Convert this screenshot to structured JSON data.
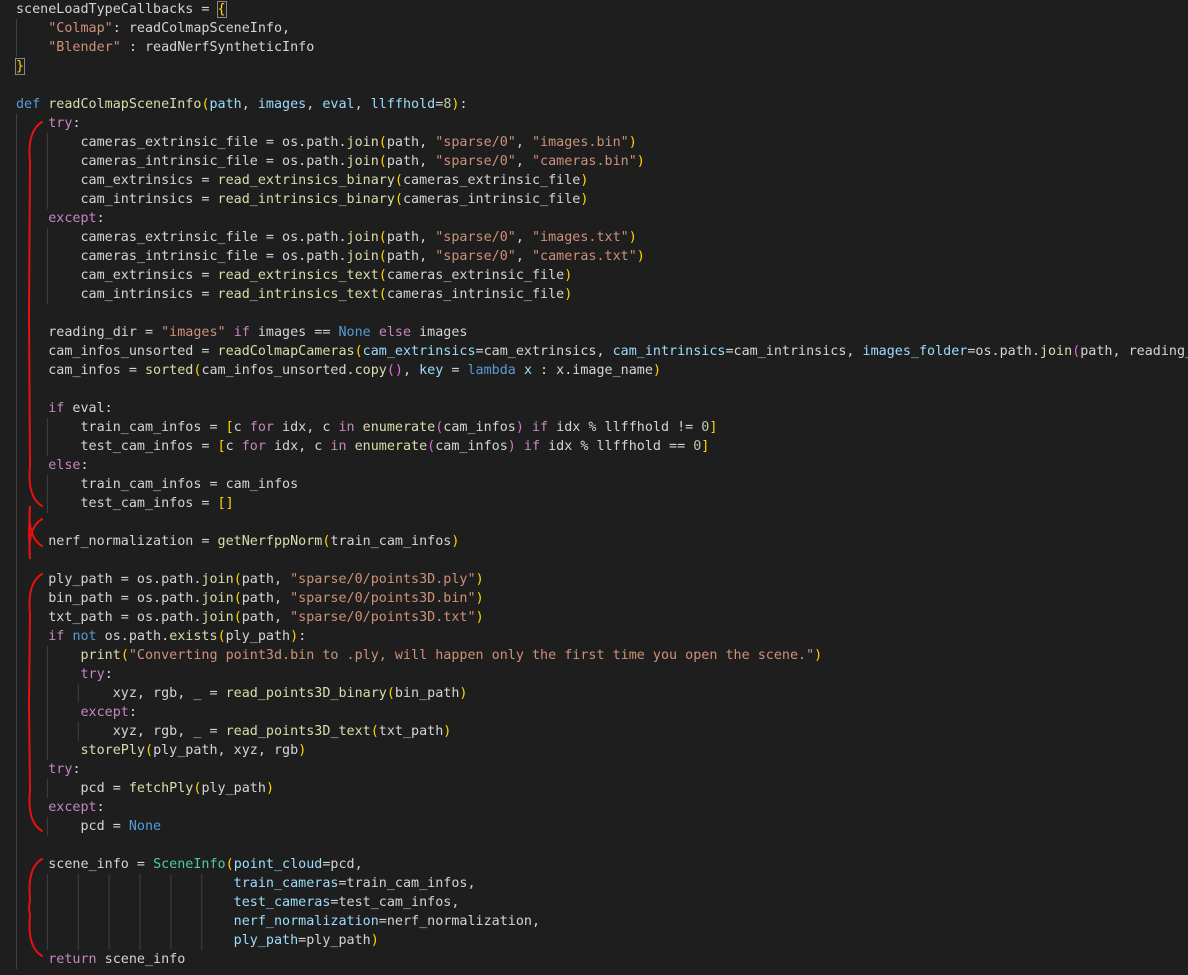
{
  "editor": {
    "language": "python",
    "colors": {
      "background": "#1e1e1e",
      "indent_guide": "#404040",
      "annotation": "#e81010"
    },
    "lines": [
      [
        [
          "sceneLoadTypeCallbacks = ",
          "op"
        ],
        [
          "{",
          "b1"
        ]
      ],
      [
        [
          "    ",
          ""
        ],
        [
          "\"Colmap\"",
          "str"
        ],
        [
          ": readColmapSceneInfo,",
          "op"
        ]
      ],
      [
        [
          "    ",
          ""
        ],
        [
          "\"Blender\"",
          "str"
        ],
        [
          " : readNerfSyntheticInfo",
          "op"
        ]
      ],
      [
        [
          "}",
          "b1"
        ]
      ],
      [],
      [
        [
          "def ",
          "kwb"
        ],
        [
          "readColmapSceneInfo",
          "fn"
        ],
        [
          "(",
          "b1"
        ],
        [
          "path",
          "var"
        ],
        [
          ", ",
          "op"
        ],
        [
          "images",
          "var"
        ],
        [
          ", ",
          "op"
        ],
        [
          "eval",
          "var"
        ],
        [
          ", ",
          "op"
        ],
        [
          "llffhold",
          "var"
        ],
        [
          "=",
          "op"
        ],
        [
          "8",
          "num"
        ],
        [
          ")",
          "b1"
        ],
        [
          ":",
          "op"
        ]
      ],
      [
        [
          "    ",
          ""
        ],
        [
          "try",
          "kw"
        ],
        [
          ":",
          "op"
        ]
      ],
      [
        [
          "        cameras_extrinsic_file = os.path.",
          "op"
        ],
        [
          "join",
          "fn"
        ],
        [
          "(",
          "b1"
        ],
        [
          "path, ",
          "op"
        ],
        [
          "\"sparse/0\"",
          "str"
        ],
        [
          ", ",
          "op"
        ],
        [
          "\"images.bin\"",
          "str"
        ],
        [
          ")",
          "b1"
        ]
      ],
      [
        [
          "        cameras_intrinsic_file = os.path.",
          "op"
        ],
        [
          "join",
          "fn"
        ],
        [
          "(",
          "b1"
        ],
        [
          "path, ",
          "op"
        ],
        [
          "\"sparse/0\"",
          "str"
        ],
        [
          ", ",
          "op"
        ],
        [
          "\"cameras.bin\"",
          "str"
        ],
        [
          ")",
          "b1"
        ]
      ],
      [
        [
          "        cam_extrinsics = ",
          "op"
        ],
        [
          "read_extrinsics_binary",
          "fn"
        ],
        [
          "(",
          "b1"
        ],
        [
          "cameras_extrinsic_file",
          "op"
        ],
        [
          ")",
          "b1"
        ]
      ],
      [
        [
          "        cam_intrinsics = ",
          "op"
        ],
        [
          "read_intrinsics_binary",
          "fn"
        ],
        [
          "(",
          "b1"
        ],
        [
          "cameras_intrinsic_file",
          "op"
        ],
        [
          ")",
          "b1"
        ]
      ],
      [
        [
          "    ",
          ""
        ],
        [
          "except",
          "kw"
        ],
        [
          ":",
          "op"
        ]
      ],
      [
        [
          "        cameras_extrinsic_file = os.path.",
          "op"
        ],
        [
          "join",
          "fn"
        ],
        [
          "(",
          "b1"
        ],
        [
          "path, ",
          "op"
        ],
        [
          "\"sparse/0\"",
          "str"
        ],
        [
          ", ",
          "op"
        ],
        [
          "\"images.txt\"",
          "str"
        ],
        [
          ")",
          "b1"
        ]
      ],
      [
        [
          "        cameras_intrinsic_file = os.path.",
          "op"
        ],
        [
          "join",
          "fn"
        ],
        [
          "(",
          "b1"
        ],
        [
          "path, ",
          "op"
        ],
        [
          "\"sparse/0\"",
          "str"
        ],
        [
          ", ",
          "op"
        ],
        [
          "\"cameras.txt\"",
          "str"
        ],
        [
          ")",
          "b1"
        ]
      ],
      [
        [
          "        cam_extrinsics = ",
          "op"
        ],
        [
          "read_extrinsics_text",
          "fn"
        ],
        [
          "(",
          "b1"
        ],
        [
          "cameras_extrinsic_file",
          "op"
        ],
        [
          ")",
          "b1"
        ]
      ],
      [
        [
          "        cam_intrinsics = ",
          "op"
        ],
        [
          "read_intrinsics_text",
          "fn"
        ],
        [
          "(",
          "b1"
        ],
        [
          "cameras_intrinsic_file",
          "op"
        ],
        [
          ")",
          "b1"
        ]
      ],
      [],
      [
        [
          "    reading_dir = ",
          "op"
        ],
        [
          "\"images\"",
          "str"
        ],
        [
          " ",
          ""
        ],
        [
          "if",
          "kw"
        ],
        [
          " images == ",
          "op"
        ],
        [
          "None",
          "kwb"
        ],
        [
          " ",
          ""
        ],
        [
          "else",
          "kw"
        ],
        [
          " images",
          "op"
        ]
      ],
      [
        [
          "    cam_infos_unsorted = ",
          "op"
        ],
        [
          "readColmapCameras",
          "fn"
        ],
        [
          "(",
          "b1"
        ],
        [
          "cam_extrinsics",
          "var"
        ],
        [
          "=cam_extrinsics, ",
          "op"
        ],
        [
          "cam_intrinsics",
          "var"
        ],
        [
          "=cam_intrinsics, ",
          "op"
        ],
        [
          "images_folder",
          "var"
        ],
        [
          "=os.path.",
          "op"
        ],
        [
          "join",
          "fn"
        ],
        [
          "(",
          "b2"
        ],
        [
          "path, reading_dir",
          "op"
        ],
        [
          ")",
          "b2"
        ],
        [
          ")",
          "b1"
        ]
      ],
      [
        [
          "    cam_infos = ",
          "op"
        ],
        [
          "sorted",
          "fn"
        ],
        [
          "(",
          "b1"
        ],
        [
          "cam_infos_unsorted.",
          "op"
        ],
        [
          "copy",
          "fn"
        ],
        [
          "()",
          "b2"
        ],
        [
          ", ",
          "op"
        ],
        [
          "key",
          "var"
        ],
        [
          " = ",
          "op"
        ],
        [
          "lambda",
          "kwb"
        ],
        [
          " ",
          ""
        ],
        [
          "x",
          "var"
        ],
        [
          " : x.image_name",
          "op"
        ],
        [
          ")",
          "b1"
        ]
      ],
      [],
      [
        [
          "    ",
          ""
        ],
        [
          "if",
          "kw"
        ],
        [
          " eval:",
          "op"
        ]
      ],
      [
        [
          "        train_cam_infos = ",
          "op"
        ],
        [
          "[",
          "b1"
        ],
        [
          "c ",
          "op"
        ],
        [
          "for",
          "kw"
        ],
        [
          " idx, c ",
          "op"
        ],
        [
          "in",
          "kw"
        ],
        [
          " ",
          ""
        ],
        [
          "enumerate",
          "fn"
        ],
        [
          "(",
          "b2"
        ],
        [
          "cam_infos",
          "op"
        ],
        [
          ")",
          "b2"
        ],
        [
          " ",
          ""
        ],
        [
          "if",
          "kw"
        ],
        [
          " idx % llffhold != ",
          "op"
        ],
        [
          "0",
          "num"
        ],
        [
          "]",
          "b1"
        ]
      ],
      [
        [
          "        test_cam_infos = ",
          "op"
        ],
        [
          "[",
          "b1"
        ],
        [
          "c ",
          "op"
        ],
        [
          "for",
          "kw"
        ],
        [
          " idx, c ",
          "op"
        ],
        [
          "in",
          "kw"
        ],
        [
          " ",
          ""
        ],
        [
          "enumerate",
          "fn"
        ],
        [
          "(",
          "b2"
        ],
        [
          "cam_infos",
          "op"
        ],
        [
          ")",
          "b2"
        ],
        [
          " ",
          ""
        ],
        [
          "if",
          "kw"
        ],
        [
          " idx % llffhold == ",
          "op"
        ],
        [
          "0",
          "num"
        ],
        [
          "]",
          "b1"
        ]
      ],
      [
        [
          "    ",
          ""
        ],
        [
          "else",
          "kw"
        ],
        [
          ":",
          "op"
        ]
      ],
      [
        [
          "        train_cam_infos = cam_infos",
          "op"
        ]
      ],
      [
        [
          "        test_cam_infos = ",
          "op"
        ],
        [
          "[]",
          "b1"
        ]
      ],
      [],
      [
        [
          "    nerf_normalization = ",
          "op"
        ],
        [
          "getNerfppNorm",
          "fn"
        ],
        [
          "(",
          "b1"
        ],
        [
          "train_cam_infos",
          "op"
        ],
        [
          ")",
          "b1"
        ]
      ],
      [],
      [
        [
          "    ply_path = os.path.",
          "op"
        ],
        [
          "join",
          "fn"
        ],
        [
          "(",
          "b1"
        ],
        [
          "path, ",
          "op"
        ],
        [
          "\"sparse/0/points3D.ply\"",
          "str"
        ],
        [
          ")",
          "b1"
        ]
      ],
      [
        [
          "    bin_path = os.path.",
          "op"
        ],
        [
          "join",
          "fn"
        ],
        [
          "(",
          "b1"
        ],
        [
          "path, ",
          "op"
        ],
        [
          "\"sparse/0/points3D.bin\"",
          "str"
        ],
        [
          ")",
          "b1"
        ]
      ],
      [
        [
          "    txt_path = os.path.",
          "op"
        ],
        [
          "join",
          "fn"
        ],
        [
          "(",
          "b1"
        ],
        [
          "path, ",
          "op"
        ],
        [
          "\"sparse/0/points3D.txt\"",
          "str"
        ],
        [
          ")",
          "b1"
        ]
      ],
      [
        [
          "    ",
          ""
        ],
        [
          "if",
          "kw"
        ],
        [
          " ",
          ""
        ],
        [
          "not",
          "kwb"
        ],
        [
          " os.path.",
          "op"
        ],
        [
          "exists",
          "fn"
        ],
        [
          "(",
          "b1"
        ],
        [
          "ply_path",
          "op"
        ],
        [
          ")",
          "b1"
        ],
        [
          ":",
          "op"
        ]
      ],
      [
        [
          "        ",
          ""
        ],
        [
          "print",
          "fn"
        ],
        [
          "(",
          "b1"
        ],
        [
          "\"Converting point3d.bin to .ply, will happen only the first time you open the scene.\"",
          "str"
        ],
        [
          ")",
          "b1"
        ]
      ],
      [
        [
          "        ",
          ""
        ],
        [
          "try",
          "kw"
        ],
        [
          ":",
          "op"
        ]
      ],
      [
        [
          "            xyz, rgb, _ = ",
          "op"
        ],
        [
          "read_points3D_binary",
          "fn"
        ],
        [
          "(",
          "b1"
        ],
        [
          "bin_path",
          "op"
        ],
        [
          ")",
          "b1"
        ]
      ],
      [
        [
          "        ",
          ""
        ],
        [
          "except",
          "kw"
        ],
        [
          ":",
          "op"
        ]
      ],
      [
        [
          "            xyz, rgb, _ = ",
          "op"
        ],
        [
          "read_points3D_text",
          "fn"
        ],
        [
          "(",
          "b1"
        ],
        [
          "txt_path",
          "op"
        ],
        [
          ")",
          "b1"
        ]
      ],
      [
        [
          "        ",
          ""
        ],
        [
          "storePly",
          "fn"
        ],
        [
          "(",
          "b1"
        ],
        [
          "ply_path, xyz, rgb",
          "op"
        ],
        [
          ")",
          "b1"
        ]
      ],
      [
        [
          "    ",
          ""
        ],
        [
          "try",
          "kw"
        ],
        [
          ":",
          "op"
        ]
      ],
      [
        [
          "        pcd = ",
          "op"
        ],
        [
          "fetchPly",
          "fn"
        ],
        [
          "(",
          "b1"
        ],
        [
          "ply_path",
          "op"
        ],
        [
          ")",
          "b1"
        ]
      ],
      [
        [
          "    ",
          ""
        ],
        [
          "except",
          "kw"
        ],
        [
          ":",
          "op"
        ]
      ],
      [
        [
          "        pcd = ",
          "op"
        ],
        [
          "None",
          "kwb"
        ]
      ],
      [],
      [
        [
          "    scene_info = ",
          "op"
        ],
        [
          "SceneInfo",
          "cls"
        ],
        [
          "(",
          "b1"
        ],
        [
          "point_cloud",
          "var"
        ],
        [
          "=pcd,",
          "op"
        ]
      ],
      [
        [
          "                           ",
          ""
        ],
        [
          "train_cameras",
          "var"
        ],
        [
          "=train_cam_infos,",
          "op"
        ]
      ],
      [
        [
          "                           ",
          ""
        ],
        [
          "test_cameras",
          "var"
        ],
        [
          "=test_cam_infos,",
          "op"
        ]
      ],
      [
        [
          "                           ",
          ""
        ],
        [
          "nerf_normalization",
          "var"
        ],
        [
          "=nerf_normalization,",
          "op"
        ]
      ],
      [
        [
          "                           ",
          ""
        ],
        [
          "ply_path",
          "var"
        ],
        [
          "=ply_path",
          "op"
        ],
        [
          ")",
          "b1"
        ]
      ],
      [
        [
          "    ",
          ""
        ],
        [
          "return",
          "kw"
        ],
        [
          " scene_info",
          "op"
        ]
      ]
    ]
  }
}
